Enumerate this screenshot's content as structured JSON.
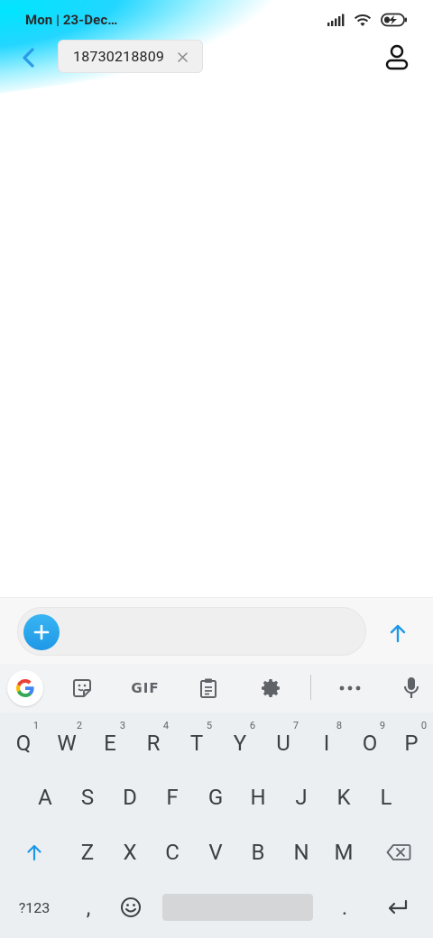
{
  "status_bar": {
    "time": "Mon | 23-Dec…"
  },
  "header": {
    "recipient": "18730218809"
  },
  "compose": {
    "placeholder": ""
  },
  "keyboard": {
    "toolbar": {
      "gif_label": "GIF"
    },
    "row1": [
      {
        "letter": "Q",
        "num": "1"
      },
      {
        "letter": "W",
        "num": "2"
      },
      {
        "letter": "E",
        "num": "3"
      },
      {
        "letter": "R",
        "num": "4"
      },
      {
        "letter": "T",
        "num": "5"
      },
      {
        "letter": "Y",
        "num": "6"
      },
      {
        "letter": "U",
        "num": "7"
      },
      {
        "letter": "I",
        "num": "8"
      },
      {
        "letter": "O",
        "num": "9"
      },
      {
        "letter": "P",
        "num": "0"
      }
    ],
    "row2": [
      "A",
      "S",
      "D",
      "F",
      "G",
      "H",
      "J",
      "K",
      "L"
    ],
    "row3": [
      "Z",
      "X",
      "C",
      "V",
      "B",
      "N",
      "M"
    ],
    "bottom": {
      "symbols_label": "?123",
      "comma": ",",
      "period": "."
    }
  },
  "colors": {
    "accent": "#1e98e6",
    "keyboard_bg": "#eceff1"
  }
}
